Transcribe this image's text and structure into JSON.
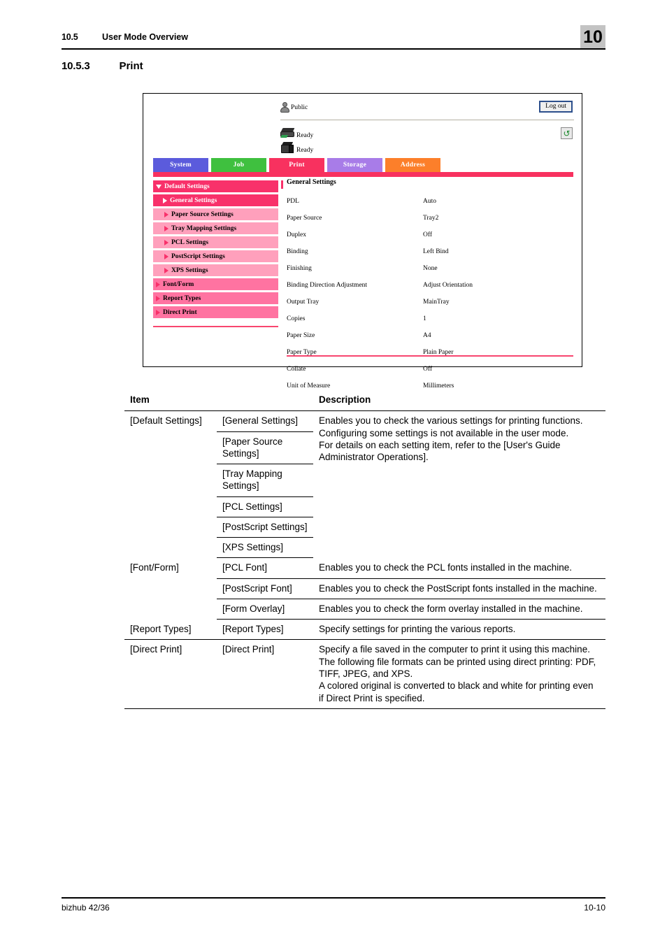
{
  "page_header": {
    "section_number": "10.5",
    "section_title": "User Mode Overview",
    "chapter_badge": "10"
  },
  "section": {
    "number": "10.5.3",
    "title": "Print"
  },
  "figure": {
    "user": {
      "name": "Public",
      "icon": "user-icon"
    },
    "logout_label": "Log out",
    "refresh_icon": "refresh-icon",
    "devices": [
      {
        "icon": "printer-icon",
        "status": "Ready"
      },
      {
        "icon": "printer-box-icon",
        "status": "Ready"
      }
    ],
    "tabs": [
      {
        "label": "System",
        "color": "#5b5bdc",
        "active": false
      },
      {
        "label": "Job",
        "color": "#3fc03f",
        "active": false
      },
      {
        "label": "Print",
        "color": "#f8315f",
        "active": true
      },
      {
        "label": "Storage",
        "color": "#a87ce8",
        "active": false
      },
      {
        "label": "Address",
        "color": "#fc7f2a",
        "active": false
      }
    ],
    "sidebar": [
      {
        "label": "Default Settings",
        "level": 1,
        "arrow": "down",
        "style": "nav-default"
      },
      {
        "label": "General Settings",
        "level": 2,
        "arrow": "right-white",
        "style": "nav-general"
      },
      {
        "label": "Paper Source Settings",
        "level": 2,
        "arrow": "right-pink",
        "style": "nav-sub"
      },
      {
        "label": "Tray Mapping Settings",
        "level": 2,
        "arrow": "right-pink",
        "style": "nav-sub"
      },
      {
        "label": "PCL Settings",
        "level": 2,
        "arrow": "right-pink",
        "style": "nav-sub"
      },
      {
        "label": "PostScript Settings",
        "level": 2,
        "arrow": "right-pink",
        "style": "nav-sub"
      },
      {
        "label": "XPS Settings",
        "level": 2,
        "arrow": "right-pink",
        "style": "nav-sub"
      },
      {
        "label": "Font/Form",
        "level": 1,
        "arrow": "right-pink",
        "style": "nav-top"
      },
      {
        "label": "Report Types",
        "level": 1,
        "arrow": "right-pink",
        "style": "nav-top"
      },
      {
        "label": "Direct Print",
        "level": 1,
        "arrow": "right-pink",
        "style": "nav-top"
      }
    ],
    "content_title": "General Settings",
    "settings": [
      {
        "label": "PDL",
        "value": "Auto"
      },
      {
        "label": "Paper Source",
        "value": "Tray2"
      },
      {
        "label": "Duplex",
        "value": "Off"
      },
      {
        "label": "Binding",
        "value": "Left Bind"
      },
      {
        "label": "Finishing",
        "value": "None"
      },
      {
        "label": "Binding Direction Adjustment",
        "value": "Adjust Orientation"
      },
      {
        "label": "Output Tray",
        "value": "MainTray"
      },
      {
        "label": "Copies",
        "value": "1"
      },
      {
        "label": "Paper Size",
        "value": "A4"
      },
      {
        "label": "Paper Type",
        "value": "Plain Paper"
      },
      {
        "label": "Collate",
        "value": "Off"
      },
      {
        "label": "Unit of Measure",
        "value": "Millimeters"
      }
    ]
  },
  "table": {
    "headers": {
      "item": "Item",
      "description": "Description"
    },
    "rows": {
      "default_settings": {
        "group": "[Default Settings]",
        "sub": [
          "[General Settings]",
          "[Paper Source Settings]",
          "[Tray Mapping Settings]",
          "[PCL Settings]",
          "[PostScript Settings]",
          "[XPS Settings]"
        ],
        "description": "Enables you to check the various settings for printing functions.\nConfiguring some settings is not available in the user mode.\nFor details on each setting item, refer to the [User's Guide Administrator Operations]."
      },
      "font_form": {
        "group": "[Font/Form]",
        "sub": [
          {
            "label": "[PCL Font]",
            "description": "Enables you to check the PCL fonts installed in the machine."
          },
          {
            "label": "[PostScript Font]",
            "description": "Enables you to check the PostScript fonts installed in the machine."
          },
          {
            "label": "[Form Overlay]",
            "description": "Enables you to check the form overlay installed in the machine."
          }
        ]
      },
      "report_types": {
        "group": "[Report Types]",
        "sub_label": "[Report Types]",
        "description": "Specify settings for printing the various reports."
      },
      "direct_print": {
        "group": "[Direct Print]",
        "sub_label": "[Direct Print]",
        "description": "Specify a file saved in the computer to print it using this machine.\nThe following file formats can be printed using direct printing: PDF, TIFF, JPEG, and XPS.\nA colored original is converted to black and white for printing even if Direct Print is specified."
      }
    }
  },
  "footer": {
    "product": "bizhub 42/36",
    "page_number": "10-10"
  }
}
